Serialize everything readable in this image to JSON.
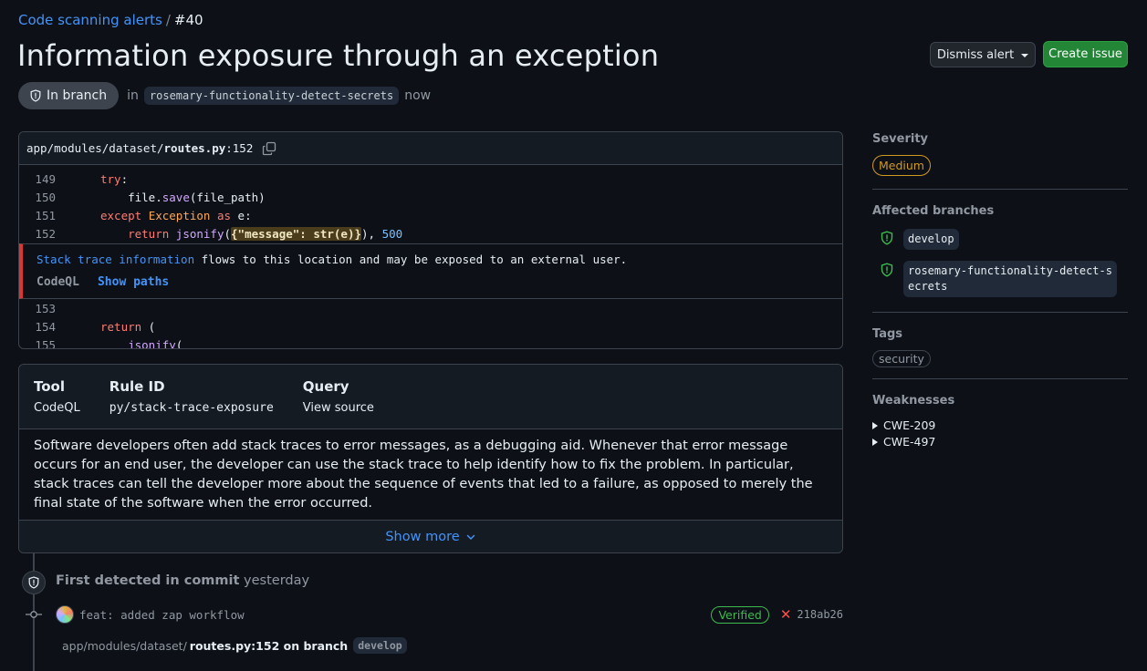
{
  "breadcrumb": {
    "parent": "Code scanning alerts",
    "separator": "/",
    "current": "#40"
  },
  "title": "Information exposure through an exception",
  "actions": {
    "dismiss": "Dismiss alert",
    "create": "Create issue"
  },
  "status": {
    "state": "In branch",
    "in_text": "in",
    "branch": "rosemary-functionality-detect-secrets",
    "time": "now"
  },
  "code": {
    "path_prefix": "app/modules/dataset/",
    "file": "routes.py",
    "line_suffix": ":152",
    "lines_before": [
      {
        "num": "149",
        "indent": "    "
      },
      {
        "num": "150",
        "indent": "        "
      },
      {
        "num": "151",
        "indent": "    "
      },
      {
        "num": "152",
        "indent": "        "
      }
    ],
    "tokens": {
      "try": "try",
      "colon": ":",
      "file_obj": "file.",
      "save": "save",
      "save_args": "(file_path)",
      "except": "except",
      "exception": "Exception",
      "as": "as",
      "e": " e:",
      "return": "return",
      "jsonify": "jsonify",
      "open_paren": "(",
      "hl_text": "{\"message\": str(e)}",
      "rest": "), ",
      "status_code": "500",
      "return2": "return",
      "paren2": " (",
      "jsonify2": "jsonify",
      "paren3": "("
    },
    "lines_after": [
      {
        "num": "153"
      },
      {
        "num": "154"
      },
      {
        "num": "155"
      }
    ],
    "alert": {
      "source": "Stack trace information",
      "message": " flows to this location and may be exposed to an external user.",
      "engine": "CodeQL",
      "show_paths": "Show paths"
    }
  },
  "rule": {
    "tool_label": "Tool",
    "tool": "CodeQL",
    "rule_label": "Rule ID",
    "rule_id": "py/stack-trace-exposure",
    "query_label": "Query",
    "query": "View source",
    "description": "Software developers often add stack traces to error messages, as a debugging aid. Whenever that error message occurs for an end user, the developer can use the stack trace to help identify how to fix the problem. In particular, stack traces can tell the developer more about the sequence of events that led to a failure, as opposed to merely the final state of the software when the error occurred.",
    "show_more": "Show more"
  },
  "timeline": {
    "first_detected": "First detected in commit",
    "when": "yesterday",
    "commit_message": "feat: added zap workflow",
    "verified": "Verified",
    "sha": "218ab26",
    "loc_path": "app/modules/dataset/",
    "loc_file": "routes.py:152 on branch",
    "loc_branch": "develop"
  },
  "sidebar": {
    "severity_title": "Severity",
    "severity": "Medium",
    "branches_title": "Affected branches",
    "branches": [
      "develop",
      "rosemary-functionality-detect-s",
      "ecrets"
    ],
    "tags_title": "Tags",
    "tags": [
      "security"
    ],
    "weak_title": "Weaknesses",
    "weaknesses": [
      "CWE-209",
      "CWE-497"
    ]
  },
  "colors": {
    "accent": "#4493f8",
    "danger": "#da3633",
    "success": "#238636",
    "warning": "#d29922"
  }
}
